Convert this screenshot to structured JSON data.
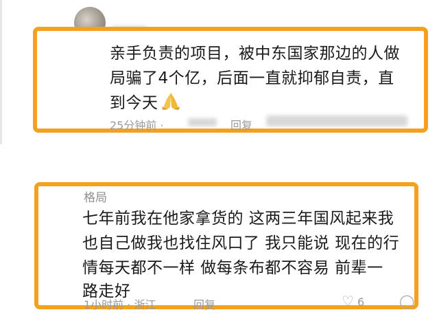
{
  "comments": [
    {
      "username": "",
      "text_lines": [
        "亲手负责的项目，被中东国家那边的人做",
        "局骗了4个亿，后面一直就抑郁自责，直",
        "到今天"
      ],
      "emoji": "praying-hands",
      "time": "25分钟前 ·",
      "reply_label": "回复"
    },
    {
      "username": "格局",
      "text_lines": [
        "七年前我在他家拿货的  这两三年国风起来我",
        "也自己做我也找住风口了  我只能说  现在的行",
        "情每天都不一样  做每条布都不容易    前辈一",
        "路走好"
      ],
      "time": "1小时前 · 浙江",
      "reply_label": "回复",
      "like_count": "6"
    }
  ],
  "colors": {
    "highlight_border": "#f5a11d",
    "meta_text": "#9a9a9a"
  },
  "icons": [
    "like-icon",
    "comment-icon",
    "praying-hands-icon"
  ]
}
